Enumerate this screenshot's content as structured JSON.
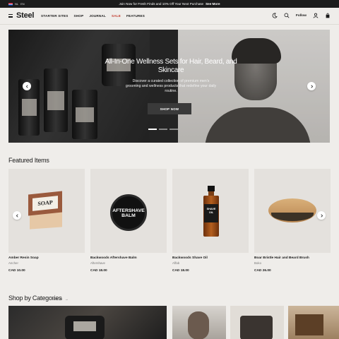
{
  "announcement": {
    "locale_lang": "NL",
    "locale_currency": "EN",
    "message": "Join Now for Fresh Finds and 10% Off Your Next Purchase",
    "link": "See More"
  },
  "header": {
    "logo": "Steel",
    "nav": [
      "STARTER SITES",
      "SHOP",
      "JOURNAL",
      "SALE",
      "FEATURES"
    ],
    "follow_label": "Follow"
  },
  "hero": {
    "title": "All-In-One Wellness Sets for Hair, Beard, and Skincare",
    "subtitle": "Discover a curated collection of premium men's grooming and wellness products that redefine your daily routine.",
    "cta": "SHOP NOW",
    "active_slide": 1,
    "slide_count": 3
  },
  "featured": {
    "title": "Featured Items",
    "products": [
      {
        "name": "Amber Resin Soap",
        "vendor": "Ancher",
        "price": "CAD 10.00",
        "art_text": "SOAP"
      },
      {
        "name": "Backwoods Aftershave Balm",
        "vendor": "Aftershave",
        "price": "CAD 18.00",
        "art_text": "AFTERSHAVE BALM"
      },
      {
        "name": "Backwoods Shave Oil",
        "vendor": "Affab",
        "price": "CAD 18.00",
        "art_text": "SHAVE OIL"
      },
      {
        "name": "Boar Bristle Hair and Beard Brush",
        "vendor": "Boko",
        "price": "CAD 26.00",
        "art_text": ""
      }
    ]
  },
  "categories": {
    "title": "Shop by Categories",
    "see_all": "See All"
  },
  "colors": {
    "background": "#efedea",
    "announcement_bg": "#1c1c1c",
    "sale": "#c0392b",
    "card_bg": "#e4e1dd",
    "cta_bg": "#3a3a3a"
  }
}
